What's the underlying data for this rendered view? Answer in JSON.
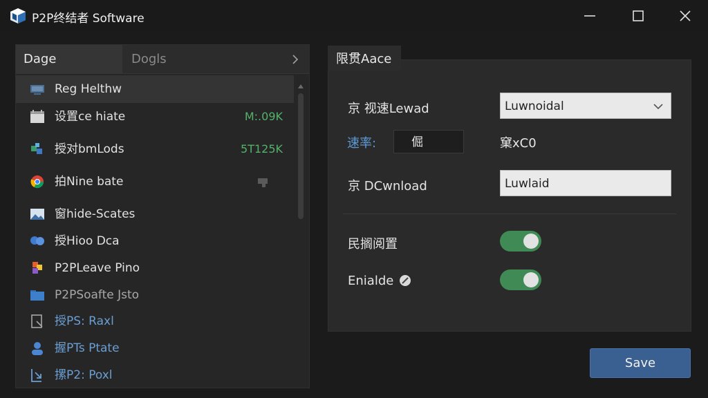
{
  "window": {
    "title": "P2P终结者 Software"
  },
  "left_panel": {
    "tabs": [
      {
        "label": "Dage",
        "active": true
      },
      {
        "label": "Dogls",
        "active": false
      }
    ],
    "items": [
      {
        "label": "Reg Helthw",
        "value": "",
        "icon": "monitor-icon",
        "selected": true
      },
      {
        "label": "设置ce hiate",
        "value": "M:.09K",
        "icon": "calendar-icon"
      },
      {
        "label": "授对bmLods",
        "value": "5T125K",
        "icon": "puzzle-icon"
      },
      {
        "label": "拍Nine bate",
        "value": "",
        "icon": "chrome-icon"
      },
      {
        "label": "窗hide-Scates",
        "value": "",
        "icon": "image-icon"
      },
      {
        "label": "授Hioo Dca",
        "value": "",
        "icon": "chat-icon"
      },
      {
        "label": "P2PLeave Pino",
        "value": "",
        "icon": "apps-icon"
      },
      {
        "label": "P2PSoafte Jsto",
        "value": "",
        "icon": "folder-icon"
      },
      {
        "label": "授PS: Raxl",
        "value": "",
        "icon": "document-icon"
      },
      {
        "label": "握PTs Ptate",
        "value": "",
        "icon": "user-icon"
      },
      {
        "label": "摞P2: Poxl",
        "value": "",
        "icon": "download-icon"
      }
    ]
  },
  "right_panel": {
    "tab_label": "限贯Aace",
    "download_mode": {
      "label": "京 视速Lewad",
      "value": "Luwnoidal"
    },
    "rate": {
      "label": "速率:",
      "box_value": "倔",
      "text": "窠xC0"
    },
    "download": {
      "label": "京 DCwnload",
      "value": "Luwlaid"
    },
    "toggle1": {
      "label": "民搁阅置",
      "on": true
    },
    "toggle2": {
      "label": "Enialde",
      "on": true
    }
  },
  "footer": {
    "save_label": "Save"
  },
  "colors": {
    "accent": "#3a5f91",
    "toggle_on": "#3f8a55",
    "value_green": "#53b36a",
    "link_blue": "#5d9ad6"
  }
}
